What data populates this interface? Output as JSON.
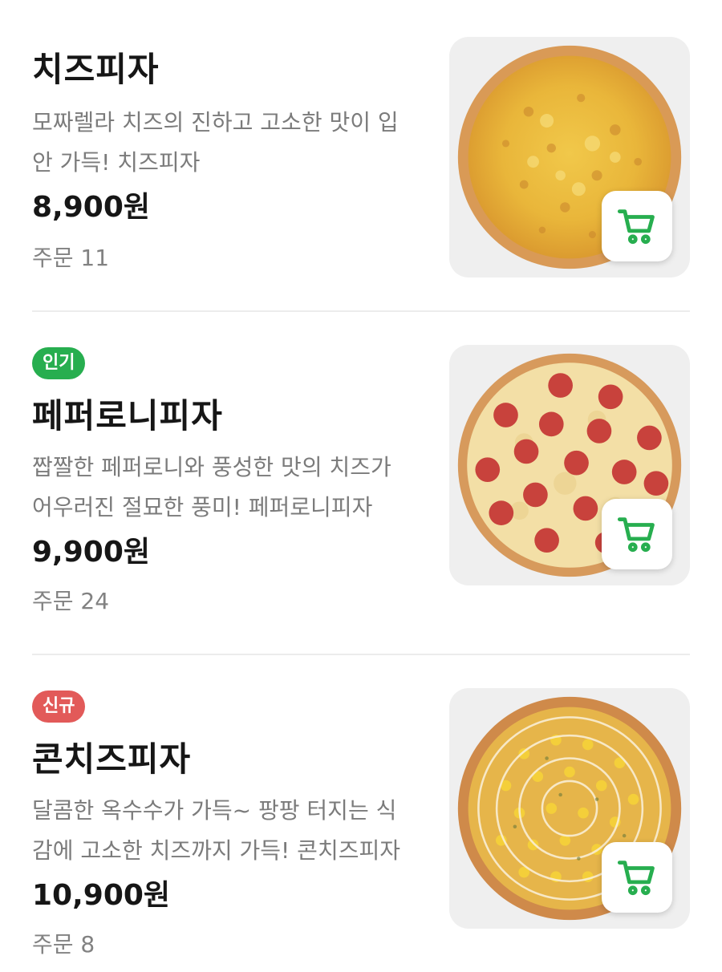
{
  "menu": {
    "items": [
      {
        "badge": "",
        "name": "치즈피자",
        "description": "모짜렐라 치즈의 진하고 고소한 맛이 입 안 가득! 치즈피자",
        "price": "8,900원",
        "orders": "주문 11",
        "image_icon": "cheese-pizza-image"
      },
      {
        "badge": "인기",
        "name": "페퍼로니피자",
        "description": "짭짤한 페퍼로니와 풍성한 맛의 치즈가 어우러진 절묘한 풍미! 페퍼로니피자",
        "price": "9,900원",
        "orders": "주문 24",
        "image_icon": "pepperoni-pizza-image"
      },
      {
        "badge": "신규",
        "name": "콘치즈피자",
        "description": "달콤한 옥수수가 가득~ 팡팡 터지는 식감에 고소한 치즈까지 가득! 콘치즈피자",
        "price": "10,900원",
        "orders": "주문 8",
        "image_icon": "corn-cheese-pizza-image"
      }
    ]
  },
  "icons": {
    "cart": "cart-icon"
  },
  "colors": {
    "accent_green": "#27ae4f",
    "badge_popular": "#27ae4f",
    "badge_new": "#e25a59",
    "text_primary": "#161616",
    "text_secondary": "#7b7b7b",
    "divider": "#ececec"
  }
}
